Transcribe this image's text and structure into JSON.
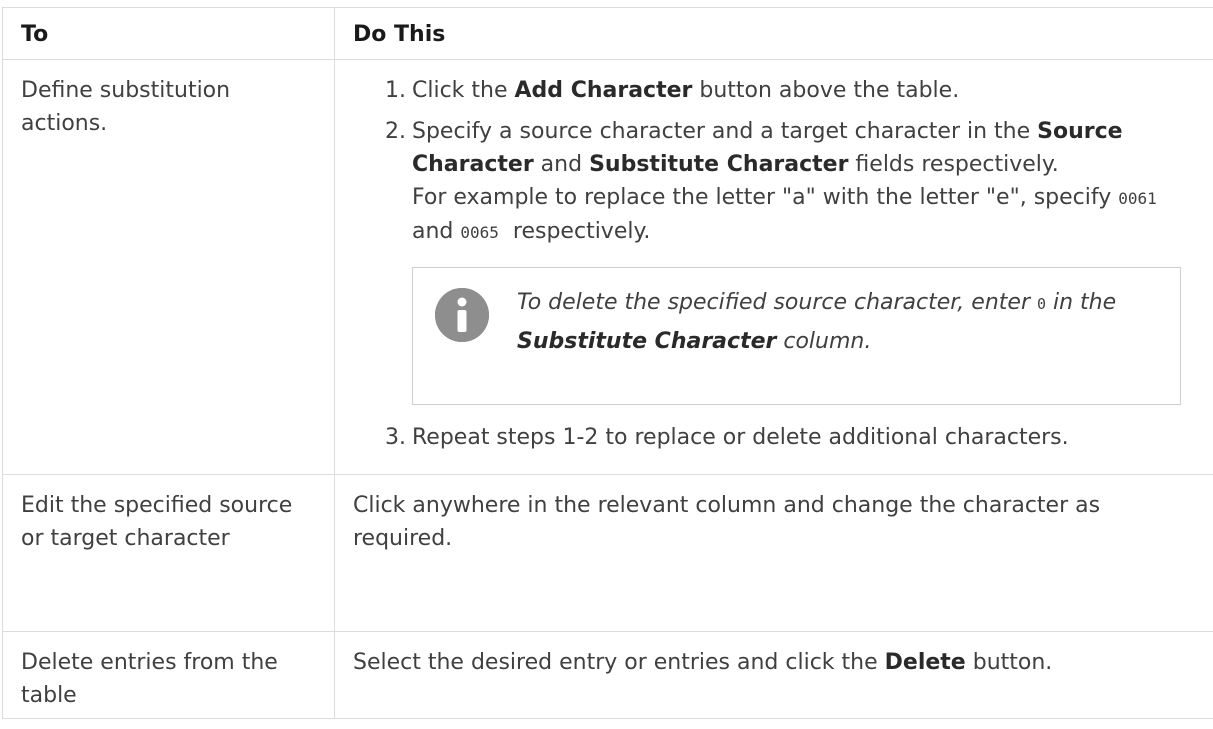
{
  "table": {
    "headers": [
      "To",
      "Do This"
    ],
    "rows": [
      {
        "to": "Define substitution actions.",
        "steps": [
          {
            "num": "1",
            "parts": [
              "Click the ",
              "Add Character",
              " button above the table."
            ]
          },
          {
            "num": "2",
            "parts": [
              "Specify a source character and a target character in the ",
              "Source Character",
              " and ",
              "Substitute Character",
              " fields respectively."
            ],
            "example": {
              "text_before": "For example to replace the letter \"a\" with the letter \"e\", specify ",
              "code1": "0061",
              "text_mid": " and ",
              "code2": "0065",
              "text_after": "  respectively."
            }
          },
          {
            "num": "3",
            "parts": [
              "Repeat steps 1-2 to replace or delete additional characters."
            ]
          }
        ],
        "note": {
          "icon": "info-icon",
          "text_before": "To delete the specified source character, enter ",
          "code": "0",
          "text_mid": " in the ",
          "bold": "Substitute Character",
          "text_after": " column."
        }
      },
      {
        "to": "Edit the specified source or target character",
        "do": "Click anywhere in the relevant column and change the character as required."
      },
      {
        "to": "Delete entries from the table",
        "do_before": "Select the desired entry or entries and click the ",
        "do_bold": "Delete",
        "do_after": " button."
      }
    ]
  }
}
